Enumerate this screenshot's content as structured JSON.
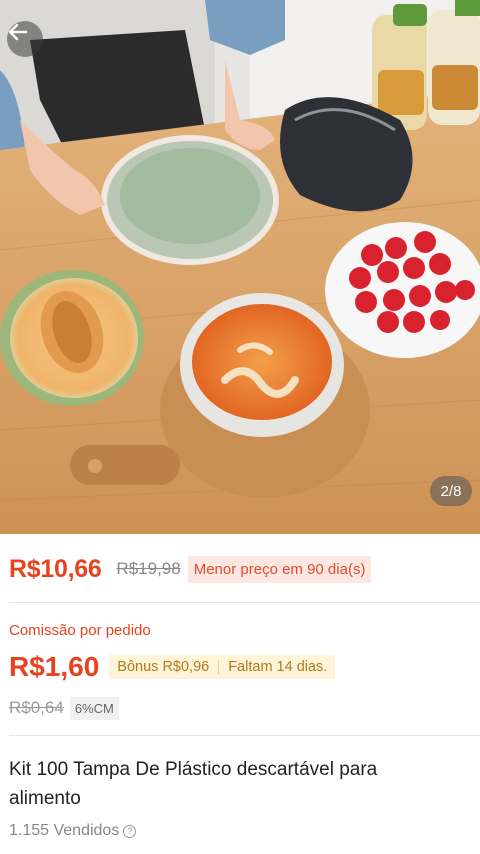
{
  "gallery": {
    "counter": "2/8"
  },
  "pricing": {
    "current_price": "R$10,66",
    "original_price": "R$19,98",
    "promo_label": "Menor preço em 90 dia(s)"
  },
  "commission": {
    "label": "Comissão por pedido",
    "value": "R$1,60",
    "bonus": "Bônus R$0,96",
    "remaining": "Faltam 14 dias.",
    "old_value": "R$0,64",
    "percent": "6%CM"
  },
  "product": {
    "title": "Kit 100 Tampa De Plástico descartável para alimento",
    "sold": "1.155 Vendidos",
    "help_symbol": "?"
  },
  "icons": {
    "back": "arrow-left-icon",
    "help": "question-circle-icon"
  },
  "colors": {
    "accent": "#e8431f",
    "promo_bg": "#fde7e2",
    "bonus_bg": "#fdf4d9"
  }
}
